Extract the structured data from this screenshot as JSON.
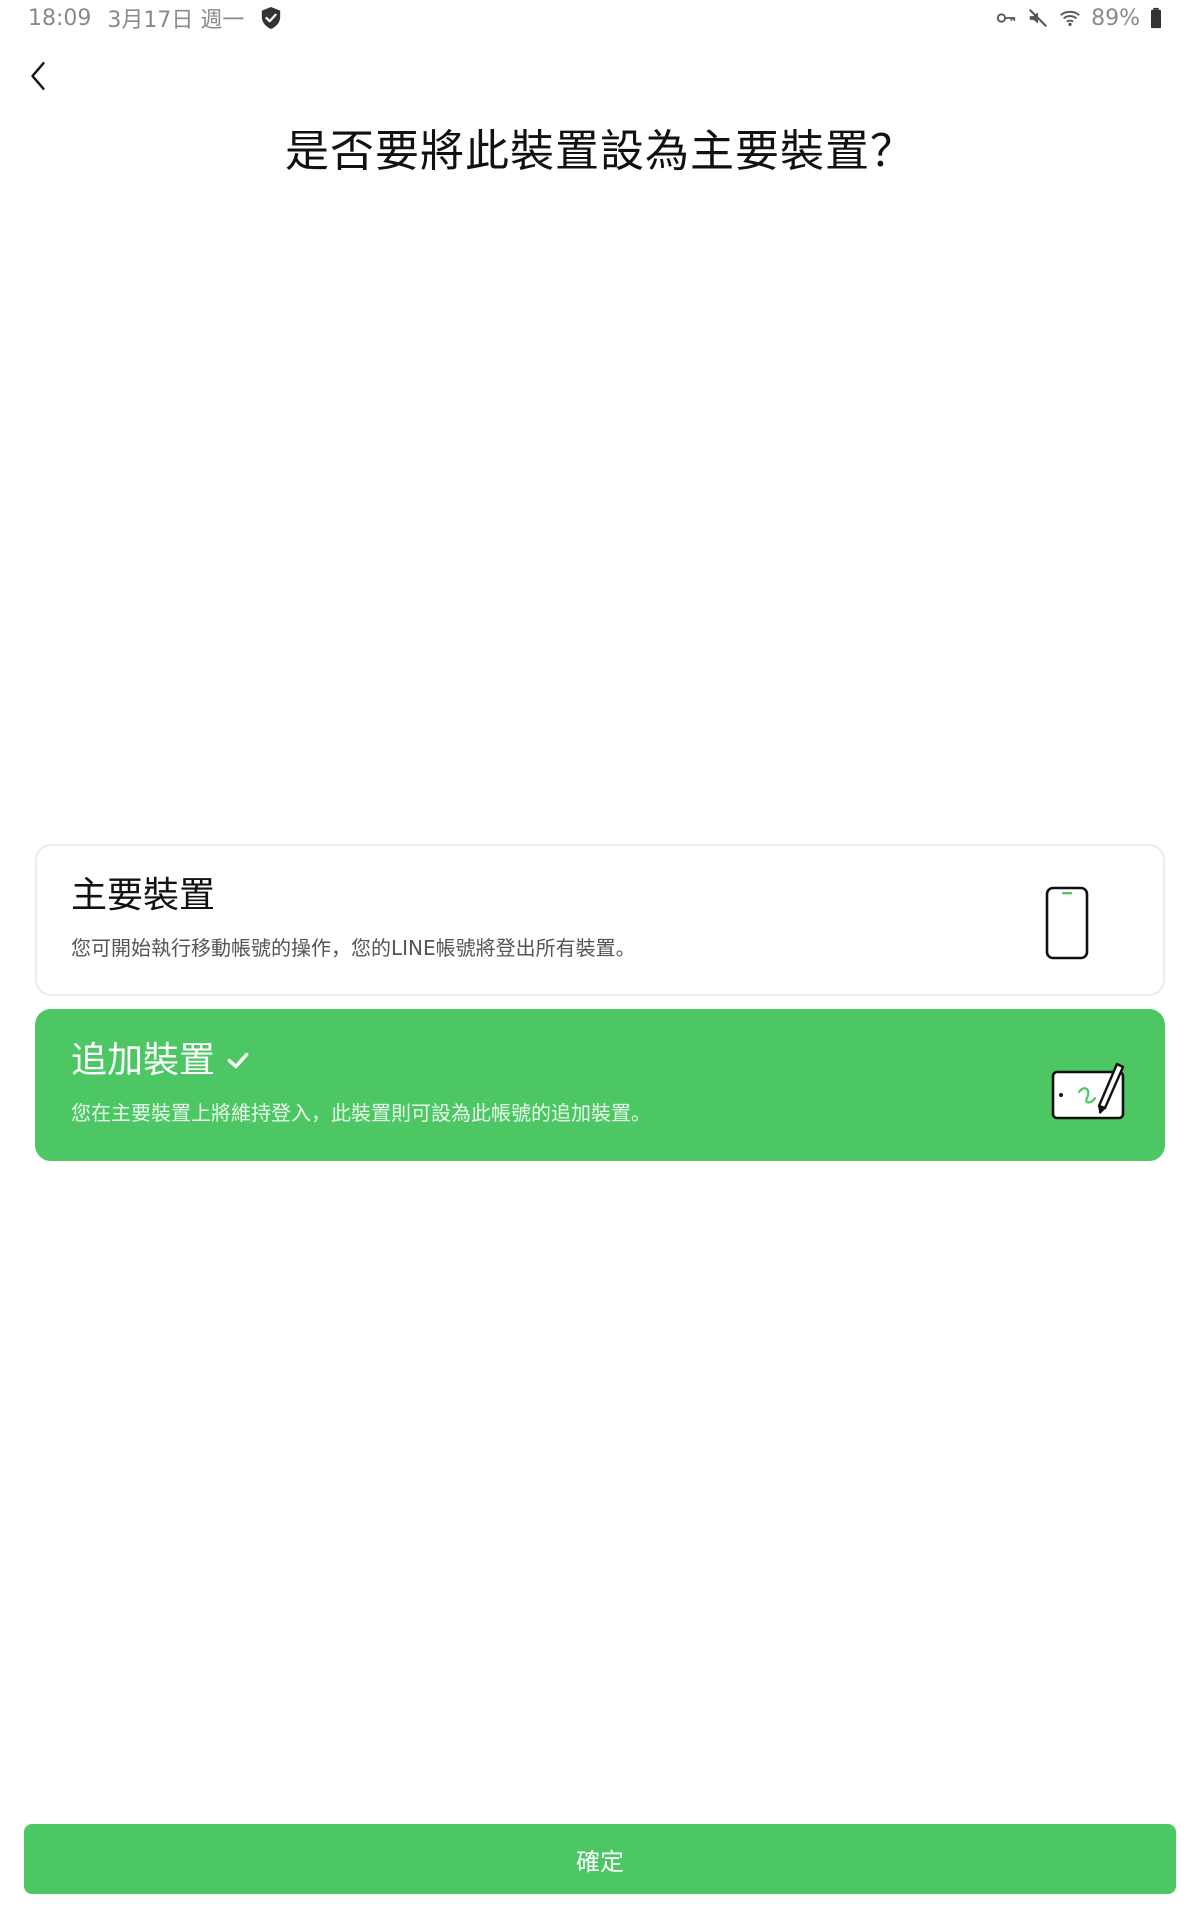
{
  "status_bar": {
    "time": "18:09",
    "date": "3月17日 週一",
    "battery": "89%",
    "icons": [
      "shield-check-icon",
      "vpn-key-icon",
      "mute-icon",
      "wifi-icon",
      "battery-icon"
    ]
  },
  "header": {
    "title": "是否要將此裝置設為主要裝置？",
    "back_icon": "chevron-left-icon"
  },
  "options": {
    "primary": {
      "title": "主要裝置",
      "description": "您可開始執行移動帳號的操作，您的LINE帳號將登出所有裝置。",
      "icon": "phone-icon",
      "selected": false
    },
    "secondary": {
      "title": "追加裝置",
      "description": "您在主要裝置上將維持登入，此裝置則可設為此帳號的追加裝置。",
      "icon": "tablet-pen-icon",
      "selected": true
    }
  },
  "footer": {
    "confirm_label": "確定"
  },
  "colors": {
    "accent": "#4cc764",
    "text": "#111111",
    "muted": "#8a8a8a"
  }
}
